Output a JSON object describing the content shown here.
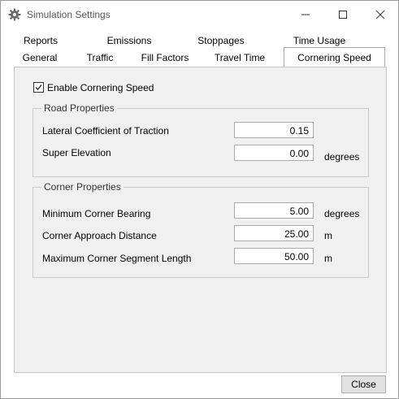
{
  "window": {
    "title": "Simulation Settings",
    "controls": {
      "minimize": "minimize",
      "maximize": "maximize",
      "close": "close"
    }
  },
  "tabs": {
    "row1": [
      "Reports",
      "Emissions",
      "Stoppages",
      "Time Usage"
    ],
    "row2": [
      "General",
      "Traffic",
      "Fill Factors",
      "Travel Time",
      "Cornering Speed"
    ],
    "selected": "Cornering Speed"
  },
  "cornering": {
    "enable_label": "Enable Cornering Speed",
    "enabled": true,
    "road_properties": {
      "title": "Road Properties",
      "rows": [
        {
          "label": "Lateral Coefficient of Traction",
          "value": "0.15",
          "unit": ""
        },
        {
          "label": "Super Elevation",
          "value": "0.00",
          "unit": "degrees"
        }
      ]
    },
    "corner_properties": {
      "title": "Corner Properties",
      "rows": [
        {
          "label": "Minimum Corner Bearing",
          "value": "5.00",
          "unit": "degrees"
        },
        {
          "label": "Corner Approach Distance",
          "value": "25.00",
          "unit": "m"
        },
        {
          "label": "Maximum Corner Segment Length",
          "value": "50.00",
          "unit": "m"
        }
      ]
    }
  },
  "footer": {
    "close_label": "Close"
  },
  "colors": {
    "panel_bg": "#f0f0f0",
    "border": "#c4c4c4",
    "icon_gray": "#666666"
  }
}
